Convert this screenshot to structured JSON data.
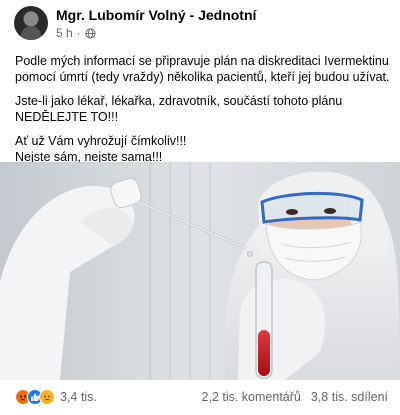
{
  "post": {
    "author": "Mgr. Lubomír Volný - Jednotní",
    "time": "5 h",
    "time_separator": "·",
    "paragraphs": [
      "Podle mých informací se připravuje plán na diskreditaci Ivermektinu\npomocí úmrtí (tedy vraždy) několika pacientů, kteří jej budou užívat.",
      "Jste-li jako lékař, lékařka, zdravotník, součástí tohoto plánu\nNEDĚLEJTE TO!!!",
      "Ať už Vám vyhrožují čímkoliv!!!\nNejste sám, nejste sama!!!"
    ]
  },
  "reactions": {
    "icons": [
      "angry-reaction-icon",
      "like-reaction-icon",
      "sad-reaction-icon"
    ],
    "count": "3,4 tis."
  },
  "stats": {
    "comments": "2,2 tis. komentářů",
    "shares": "3,8 tis. sdílení"
  },
  "colors": {
    "like": "#1877f2",
    "angry": "#e9710f",
    "sad": "#f7b125",
    "secondary_text": "#65676b",
    "blood": "#c4161c"
  }
}
